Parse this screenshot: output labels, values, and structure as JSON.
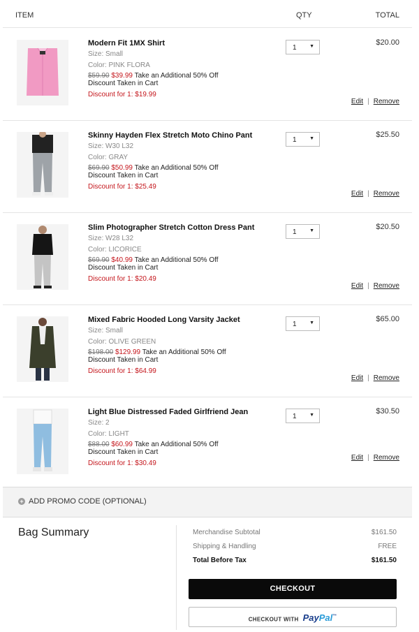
{
  "header": {
    "item": "ITEM",
    "qty": "QTY",
    "total": "TOTAL"
  },
  "items": [
    {
      "title": "Modern Fit 1MX Shirt",
      "size": "Size: Small",
      "color": "Color: PINK FLORA",
      "orig_price": "$59.90",
      "sale_price": "$39.99",
      "offer": "Take an Additional 50% Off",
      "note": "Discount Taken in Cart",
      "discount": "Discount for 1: $19.99",
      "qty": "1",
      "total": "$20.00",
      "edit": "Edit",
      "remove": "Remove",
      "image_color": "#f19ac3"
    },
    {
      "title": "Skinny Hayden Flex Stretch Moto Chino Pant",
      "size": "Size: W30 L32",
      "color": "Color: GRAY",
      "orig_price": "$69.90",
      "sale_price": "$50.99",
      "offer": "Take an Additional 50% Off",
      "note": "Discount Taken in Cart",
      "discount": "Discount for 1: $25.49",
      "qty": "1",
      "total": "$25.50",
      "edit": "Edit",
      "remove": "Remove",
      "image_color": "#9ea3a8"
    },
    {
      "title": "Slim Photographer Stretch Cotton Dress Pant",
      "size": "Size: W28 L32",
      "color": "Color: LICORICE",
      "orig_price": "$69.90",
      "sale_price": "$40.99",
      "offer": "Take an Additional 50% Off",
      "note": "Discount Taken in Cart",
      "discount": "Discount for 1: $20.49",
      "qty": "1",
      "total": "$20.50",
      "edit": "Edit",
      "remove": "Remove",
      "image_color": "#c4c4c4"
    },
    {
      "title": "Mixed Fabric Hooded Long Varsity Jacket",
      "size": "Size: Small",
      "color": "Color: OLIVE GREEN",
      "orig_price": "$198.00",
      "sale_price": "$129.99",
      "offer": "Take an Additional 50% Off",
      "note": "Discount Taken in Cart",
      "discount": "Discount for 1: $64.99",
      "qty": "1",
      "total": "$65.00",
      "edit": "Edit",
      "remove": "Remove",
      "image_color": "#3b3f2c"
    },
    {
      "title": "Light Blue Distressed Faded Girlfriend Jean",
      "size": "Size: 2",
      "color": "Color: LIGHT",
      "orig_price": "$88.00",
      "sale_price": "$60.99",
      "offer": "Take an Additional 50% Off",
      "note": "Discount Taken in Cart",
      "discount": "Discount for 1: $30.49",
      "qty": "1",
      "total": "$30.50",
      "edit": "Edit",
      "remove": "Remove",
      "image_color": "#8fbde0"
    }
  ],
  "promo": {
    "icon": "plus-circle-icon",
    "label": "ADD PROMO CODE (OPTIONAL)"
  },
  "summary": {
    "title": "Bag Summary",
    "rows": [
      {
        "label": "Merchandise Subtotal",
        "value": "$161.50"
      },
      {
        "label": "Shipping & Handling",
        "value": "FREE"
      },
      {
        "label": "Total Before Tax",
        "value": "$161.50"
      }
    ],
    "checkout": "CHECKOUT",
    "paypal_prefix": "CHECKOUT WITH",
    "paypal_brand_a": "Pay",
    "paypal_brand_b": "Pal",
    "paypal_tm": "™"
  },
  "colors": {
    "accent_red": "#c4161c",
    "checkout_bg": "#0a0a0a",
    "paypal_blue": "#1a3e8c"
  }
}
